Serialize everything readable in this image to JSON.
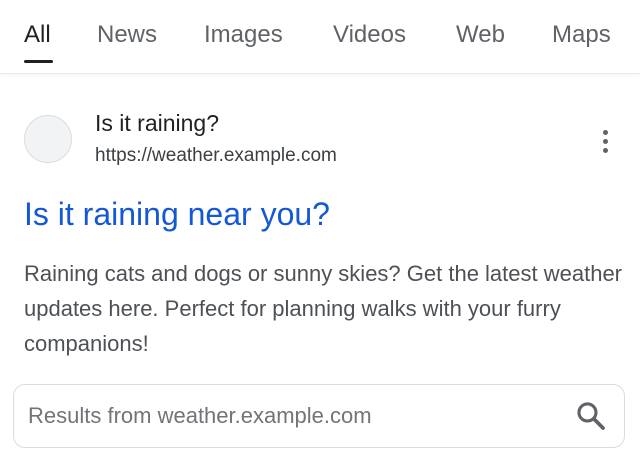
{
  "tabs": [
    {
      "label": "All",
      "active": true
    },
    {
      "label": "News",
      "active": false
    },
    {
      "label": "Images",
      "active": false
    },
    {
      "label": "Videos",
      "active": false
    },
    {
      "label": "Web",
      "active": false
    },
    {
      "label": "Maps",
      "active": false
    }
  ],
  "result": {
    "favicon_icon": "site-favicon-placeholder",
    "site_name": "Is it raining?",
    "url": "https://weather.example.com",
    "menu_icon": "more-vert-icon",
    "title": "Is it raining near you?",
    "snippet": "Raining cats and dogs or sunny skies? Get the latest weather updates here. Perfect for planning walks with your furry companions!"
  },
  "site_search": {
    "text": "Results from weather.example.com",
    "icon": "search-icon"
  },
  "colors": {
    "link": "#1558d6",
    "text": "#202124",
    "muted": "#5f6368",
    "border": "#dadce0"
  }
}
